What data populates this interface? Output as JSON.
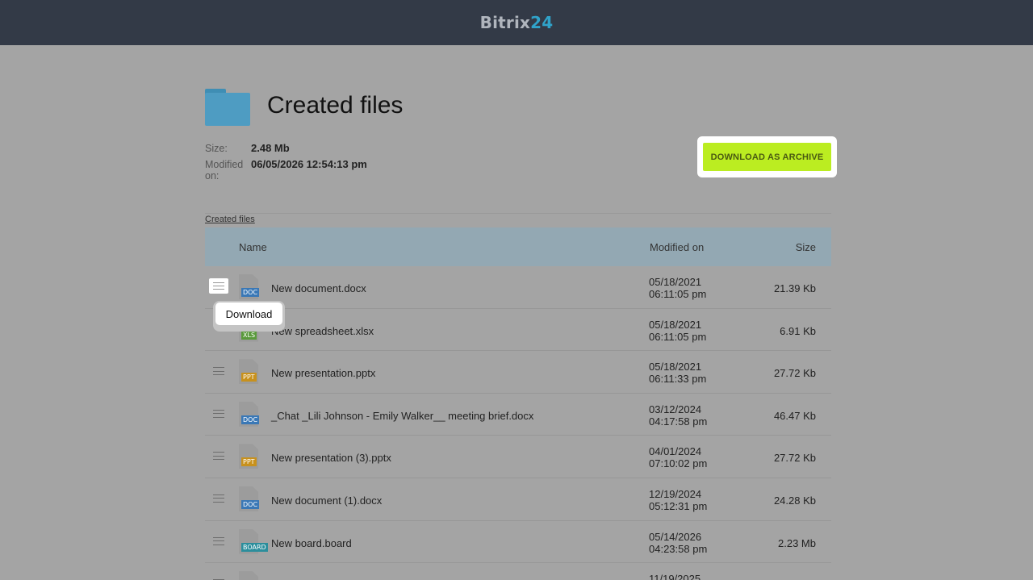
{
  "header": {
    "logo_text": "Bitrix",
    "logo_num": "24"
  },
  "folder": {
    "title": "Created files",
    "size_label": "Size:",
    "size_value": "2.48 Mb",
    "modified_label_1": "Modified",
    "modified_label_2": "on:",
    "modified_value": "06/05/2026 12:54:13 pm",
    "archive_button": "DOWNLOAD AS ARCHIVE",
    "breadcrumb": "Created files"
  },
  "table": {
    "col_name": "Name",
    "col_modified": "Modified on",
    "col_size": "Size",
    "rows": [
      {
        "name": "New document.docx",
        "date": "05/18/2021",
        "time": "06:11:05 pm",
        "size": "21.39 Kb",
        "type": "DOC",
        "color": "#3a78b6"
      },
      {
        "name": "New spreadsheet.xlsx",
        "date": "05/18/2021",
        "time": "06:11:05 pm",
        "size": "6.91 Kb",
        "type": "XLS",
        "color": "#5a9a3c"
      },
      {
        "name": "New presentation.pptx",
        "date": "05/18/2021",
        "time": "06:11:33 pm",
        "size": "27.72 Kb",
        "type": "PPT",
        "color": "#c8911d"
      },
      {
        "name": "_Chat _Lili Johnson - Emily Walker__ meeting brief.docx",
        "date": "03/12/2024",
        "time": "04:17:58 pm",
        "size": "46.47 Kb",
        "type": "DOC",
        "color": "#3a78b6"
      },
      {
        "name": "New presentation (3).pptx",
        "date": "04/01/2024",
        "time": "07:10:02 pm",
        "size": "27.72 Kb",
        "type": "PPT",
        "color": "#c8911d"
      },
      {
        "name": "New document (1).docx",
        "date": "12/19/2024",
        "time": "05:12:31 pm",
        "size": "24.28 Kb",
        "type": "DOC",
        "color": "#3a78b6"
      },
      {
        "name": "New board.board",
        "date": "05/14/2026",
        "time": "04:23:58 pm",
        "size": "2.23 Mb",
        "type": "BOARD",
        "color": "#2c8e9c"
      },
      {
        "name": "",
        "date": "11/19/2025",
        "time": "",
        "size": "",
        "type": "",
        "color": "#9c9c9c"
      }
    ]
  },
  "tooltip": {
    "label": "Download"
  }
}
